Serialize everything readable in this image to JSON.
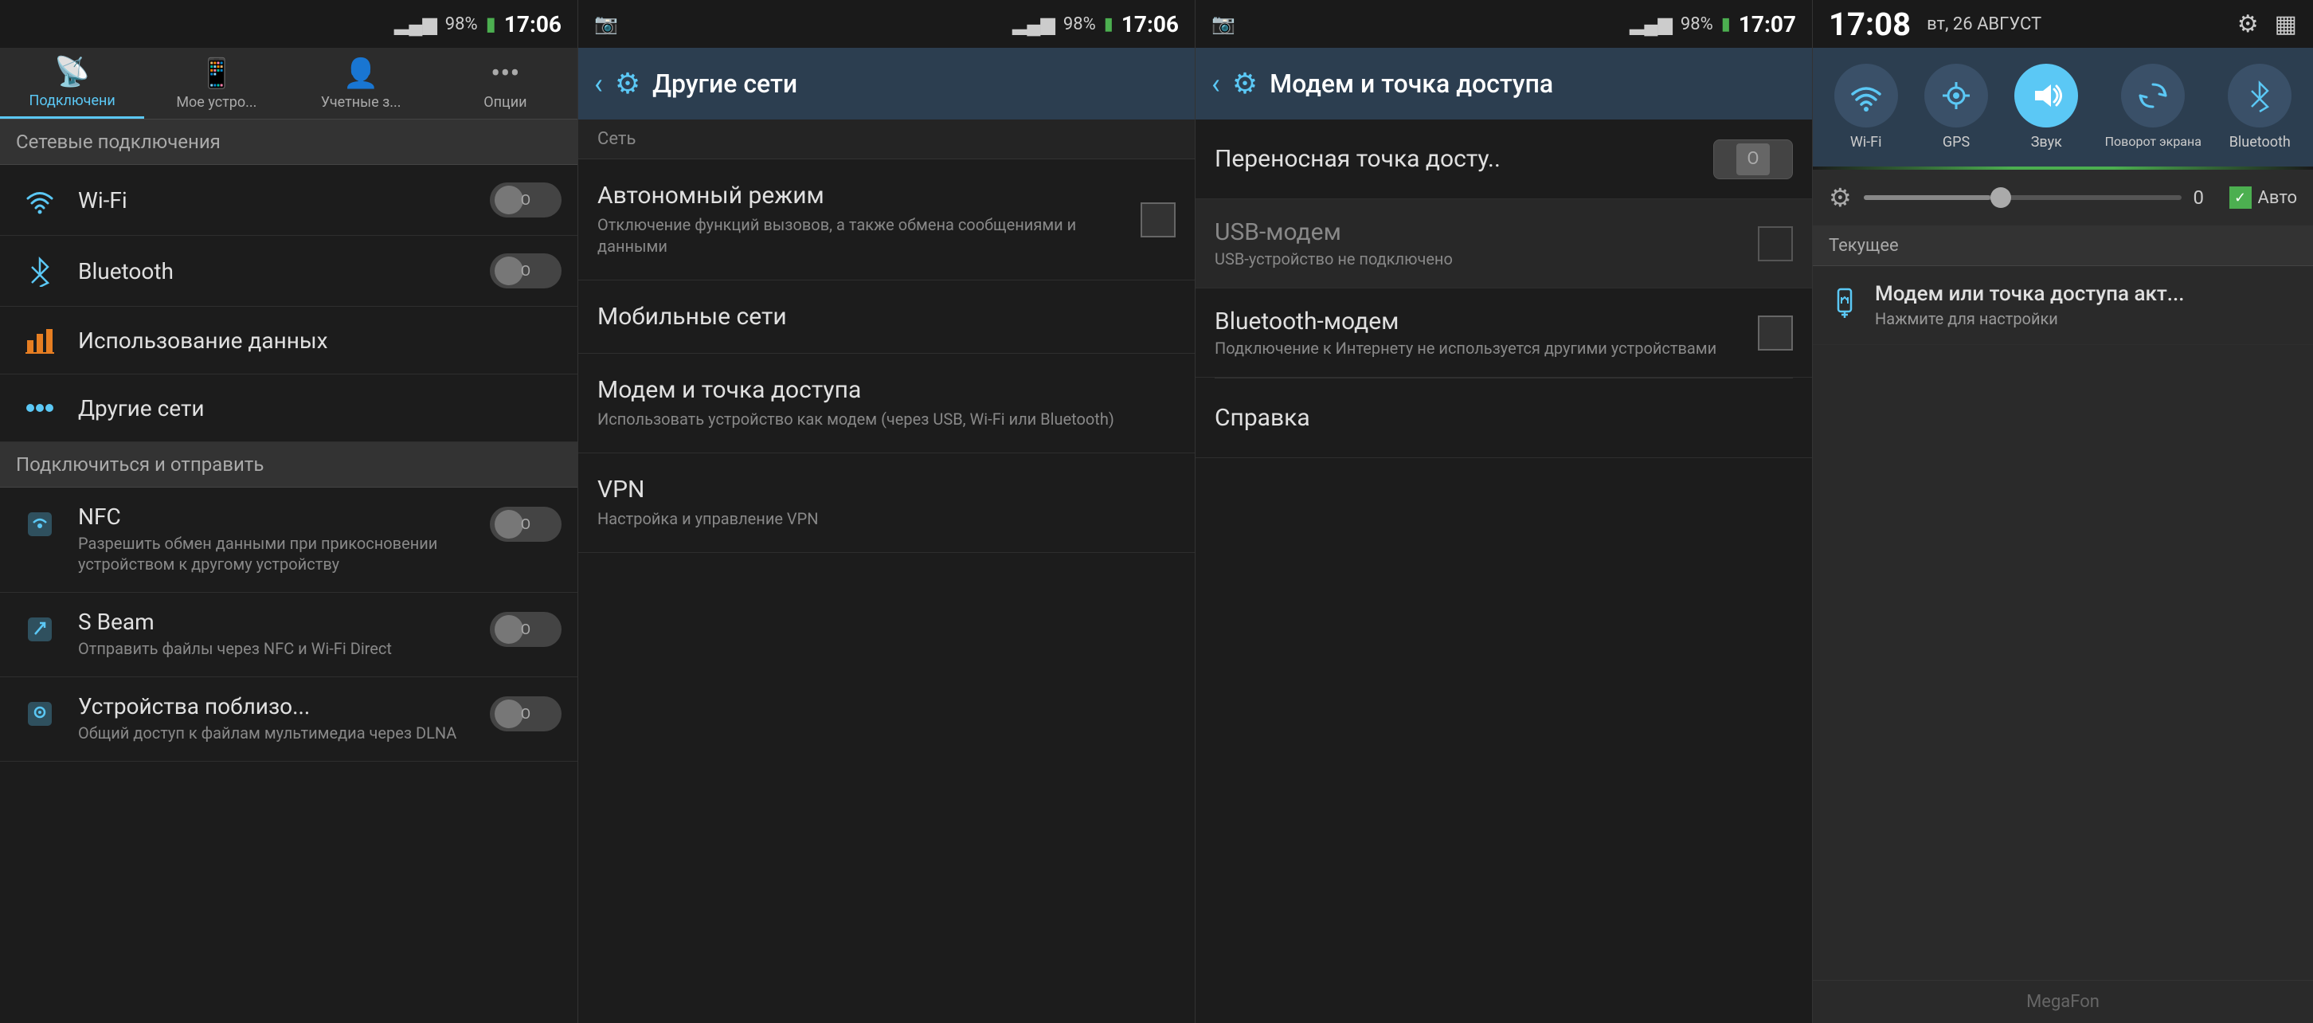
{
  "panel1": {
    "statusBar": {
      "signal": "▂▄▆█",
      "battery": "98%",
      "time": "17:06",
      "batteryIcon": "🔋"
    },
    "tabs": [
      {
        "label": "Подключени",
        "icon": "📡",
        "active": true
      },
      {
        "label": "Мое устро...",
        "icon": "📱",
        "active": false
      },
      {
        "label": "Учетные з...",
        "icon": "👤",
        "active": false
      },
      {
        "label": "Опции",
        "icon": "⋯",
        "active": false
      }
    ],
    "sectionHeader": "Сетевые подключения",
    "items": [
      {
        "icon": "wifi",
        "title": "Wi-Fi",
        "toggle": "off",
        "subtitle": ""
      },
      {
        "icon": "bluetooth",
        "title": "Bluetooth",
        "toggle": "off",
        "subtitle": ""
      },
      {
        "icon": "data",
        "title": "Использование данных",
        "toggle": null,
        "subtitle": ""
      },
      {
        "icon": "other",
        "title": "Другие сети",
        "toggle": null,
        "subtitle": ""
      }
    ],
    "section2Header": "Подключиться и отправить",
    "items2": [
      {
        "icon": "nfc",
        "title": "NFC",
        "subtitle": "Разрешить обмен данными при прикосновении устройством к другому устройству",
        "toggle": "off"
      },
      {
        "icon": "sbeam",
        "title": "S Beam",
        "subtitle": "Отправить файлы через NFC и Wi-Fi Direct",
        "toggle": "off"
      },
      {
        "icon": "nearby",
        "title": "Устройства поблизо...",
        "subtitle": "Общий доступ к файлам мультимедиа через DLNA",
        "toggle": "off"
      }
    ]
  },
  "panel2": {
    "statusBar": {
      "battery": "98%",
      "time": "17:06"
    },
    "header": {
      "back": "‹",
      "icon": "⚙",
      "title": "Другие сети"
    },
    "sectionHeader": "Сеть",
    "items": [
      {
        "title": "Автономный режим",
        "subtitle": "Отключение функций вызовов, а также обмена сообщениями и данными"
      },
      {
        "title": "Мобильные сети",
        "subtitle": ""
      },
      {
        "title": "Модем и точка доступа",
        "subtitle": "Использовать устройство как модем (через USB, Wi-Fi или Bluetooth)"
      },
      {
        "title": "VPN",
        "subtitle": "Настройка и управление VPN"
      }
    ]
  },
  "panel3": {
    "statusBar": {
      "battery": "98%",
      "time": "17:07"
    },
    "header": {
      "back": "‹",
      "icon": "⚙",
      "title": "Модем и точка доступа"
    },
    "items": [
      {
        "title": "Переносная точка досту..",
        "subtitle": "",
        "control": "toggle"
      },
      {
        "title": "USB-модем",
        "subtitle": "USB-устройство не подключено",
        "control": "checkbox"
      },
      {
        "title": "Bluetooth-модем",
        "subtitle": "Подключение к Интернету не используется другими устройствами",
        "control": "checkbox"
      },
      {
        "title": "Справка",
        "subtitle": "",
        "control": "none"
      }
    ]
  },
  "panel4": {
    "statusBar": {
      "time": "17:08",
      "date": "вт, 26 АВГУСТ",
      "icons": [
        "⚙",
        "▦"
      ]
    },
    "tiles": [
      {
        "icon": "wifi",
        "label": "Wi-Fi",
        "active": false
      },
      {
        "icon": "gps",
        "label": "GPS",
        "active": false
      },
      {
        "icon": "sound",
        "label": "Звук",
        "active": true
      },
      {
        "icon": "rotate",
        "label": "Поворот экрана",
        "active": false
      },
      {
        "icon": "bluetooth",
        "label": "Bluetooth",
        "active": false
      }
    ],
    "brightness": {
      "value": "0",
      "autoLabel": "Авто"
    },
    "currentSection": "Текущее",
    "notifications": [
      {
        "icon": "usb",
        "title": "Модем или точка доступа акт...",
        "subtitle": "Нажмите для настройки"
      }
    ],
    "footer": "MegaFon"
  }
}
